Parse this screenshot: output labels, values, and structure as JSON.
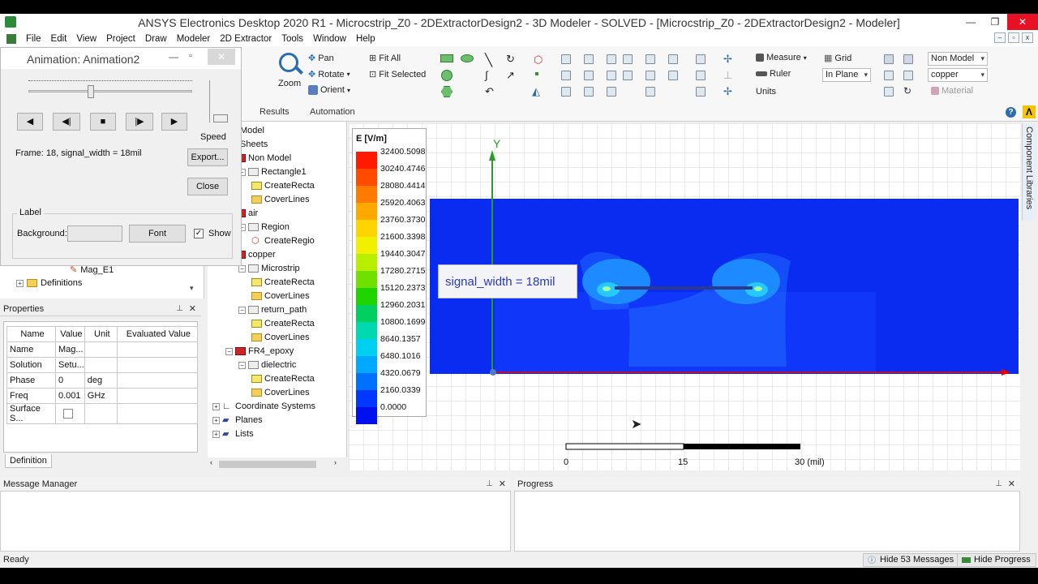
{
  "title": "ANSYS Electronics Desktop 2020 R1 - Microcstrip_Z0 - 2DExtractorDesign2 - 3D Modeler - SOLVED - [Microcstrip_Z0 - 2DExtractorDesign2 - Modeler]",
  "menu": [
    "File",
    "Edit",
    "View",
    "Project",
    "Draw",
    "Modeler",
    "2D Extractor",
    "Tools",
    "Window",
    "Help"
  ],
  "ribbon": {
    "zoom": "Zoom",
    "pan": "Pan",
    "rotate": "Rotate",
    "orient": "Orient",
    "fit_all": "Fit All",
    "fit_selected": "Fit Selected",
    "results": "Results",
    "automation": "Automation",
    "measure": "Measure",
    "ruler": "Ruler",
    "units": "Units",
    "grid": "Grid",
    "in_plane": "In Plane",
    "non_model": "Non Model",
    "copper": "copper",
    "material": "Material"
  },
  "animation": {
    "title": "Animation: Animation2",
    "speed": "Speed",
    "frame": "Frame: 18, signal_width = 18mil",
    "export": "Export...",
    "close": "Close",
    "label_group": "Label",
    "background": "Background:",
    "font": "Font",
    "show": "Show",
    "slider_fraction": 0.38
  },
  "left_tree_partial": {
    "mag": "Mag_E1",
    "definitions": "Definitions"
  },
  "tree": [
    {
      "label": "Model",
      "indent": 0,
      "icon": "none",
      "box": ""
    },
    {
      "label": "Sheets",
      "indent": 0,
      "icon": "none",
      "box": ""
    },
    {
      "label": "Non Model",
      "indent": 1,
      "icon": "red",
      "box": "−"
    },
    {
      "label": "Rectangle1",
      "indent": 2,
      "icon": "gray",
      "box": "−"
    },
    {
      "label": "CreateRecta",
      "indent": 3,
      "icon": "yellow",
      "box": ""
    },
    {
      "label": "CoverLines",
      "indent": 3,
      "icon": "folder",
      "box": ""
    },
    {
      "label": "air",
      "indent": 1,
      "icon": "red",
      "box": "−"
    },
    {
      "label": "Region",
      "indent": 2,
      "icon": "gray",
      "box": "−"
    },
    {
      "label": "CreateRegio",
      "indent": 3,
      "icon": "cube",
      "box": ""
    },
    {
      "label": "copper",
      "indent": 1,
      "icon": "red",
      "box": "−"
    },
    {
      "label": "Microstrip",
      "indent": 2,
      "icon": "gray",
      "box": "−"
    },
    {
      "label": "CreateRecta",
      "indent": 3,
      "icon": "yellow",
      "box": ""
    },
    {
      "label": "CoverLines",
      "indent": 3,
      "icon": "folder",
      "box": ""
    },
    {
      "label": "return_path",
      "indent": 2,
      "icon": "gray",
      "box": "−"
    },
    {
      "label": "CreateRecta",
      "indent": 3,
      "icon": "yellow",
      "box": ""
    },
    {
      "label": "CoverLines",
      "indent": 3,
      "icon": "folder",
      "box": ""
    },
    {
      "label": "FR4_epoxy",
      "indent": 1,
      "icon": "red",
      "box": "−"
    },
    {
      "label": "dielectric",
      "indent": 2,
      "icon": "gray",
      "box": "−"
    },
    {
      "label": "CreateRecta",
      "indent": 3,
      "icon": "yellow",
      "box": ""
    },
    {
      "label": "CoverLines",
      "indent": 3,
      "icon": "folder",
      "box": ""
    },
    {
      "label": "Coordinate Systems",
      "indent": 0,
      "icon": "coord",
      "box": "+"
    },
    {
      "label": "Planes",
      "indent": 0,
      "icon": "planes",
      "box": "+"
    },
    {
      "label": "Lists",
      "indent": 0,
      "icon": "lists",
      "box": "+"
    }
  ],
  "properties": {
    "title": "Properties",
    "headers": [
      "Name",
      "Value",
      "Unit",
      "Evaluated Value"
    ],
    "rows": [
      [
        "Name",
        "Mag...",
        "",
        ""
      ],
      [
        "Solution",
        "Setu...",
        "",
        ""
      ],
      [
        "Phase",
        "0",
        "deg",
        ""
      ],
      [
        "Freq",
        "0.001",
        "GHz",
        ""
      ],
      [
        "Surface S...",
        "",
        "",
        ""
      ]
    ],
    "tab": "Definition"
  },
  "legend": {
    "title": "E [V/m]",
    "values": [
      "32400.5098",
      "30240.4746",
      "28080.4414",
      "25920.4063",
      "23760.3730",
      "21600.3398",
      "19440.3047",
      "17280.2715",
      "15120.2373",
      "12960.2031",
      "10800.1699",
      "8640.1357",
      "6480.1016",
      "4320.0679",
      "2160.0339",
      "0.0000"
    ],
    "colors": [
      "#ff1a00",
      "#ff4a00",
      "#ff7a00",
      "#ffa800",
      "#ffd400",
      "#f0f000",
      "#b8ee00",
      "#70e000",
      "#20d400",
      "#00d060",
      "#00d8b0",
      "#00d0f0",
      "#00a8ff",
      "#0070ff",
      "#0038ff",
      "#0010ee"
    ]
  },
  "viewport": {
    "signal_label": "signal_width = 18mil",
    "axis_y": "Y",
    "scale_labels": [
      "0",
      "15",
      "30 (mil)"
    ]
  },
  "component_libraries": "Component Libraries",
  "panels": {
    "message_manager": "Message Manager",
    "progress": "Progress"
  },
  "status": {
    "ready": "Ready",
    "hide_messages": "Hide 53 Messages",
    "hide_progress": "Hide Progress"
  }
}
